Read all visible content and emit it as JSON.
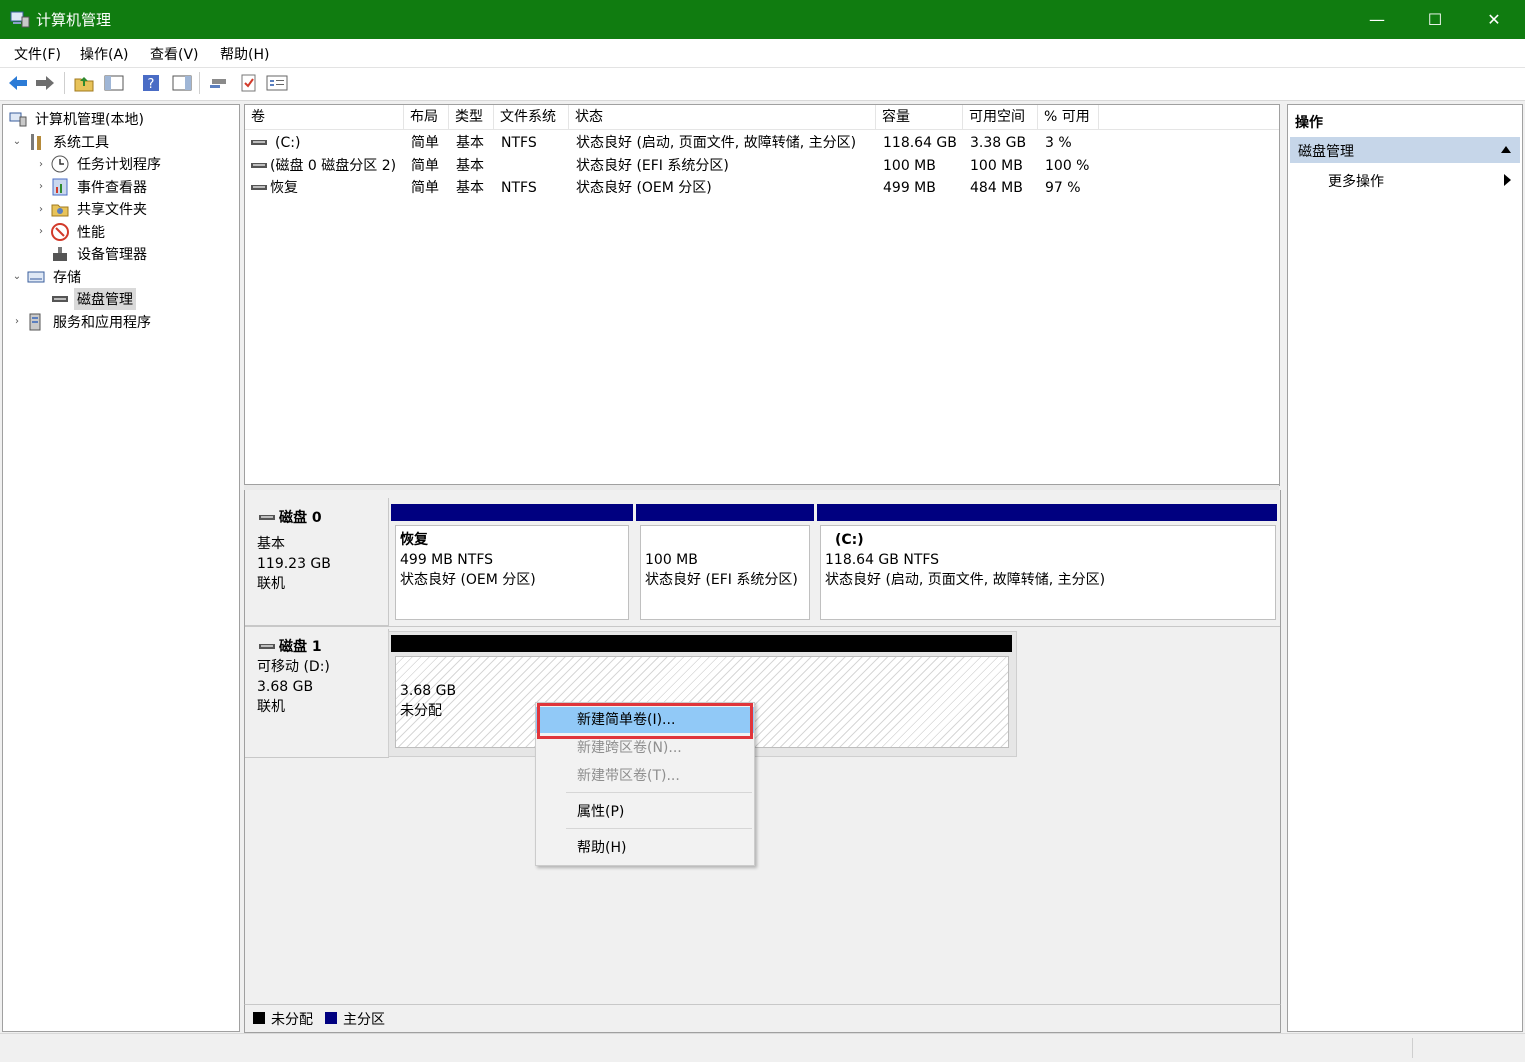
{
  "window": {
    "title": "计算机管理",
    "minimize": "—",
    "maximize": "☐",
    "close": "✕"
  },
  "menu": [
    "文件(F)",
    "操作(A)",
    "查看(V)",
    "帮助(H)"
  ],
  "toolbar_icons": [
    "back-icon",
    "forward-icon",
    "folder-up-icon",
    "show-hide-tree-icon",
    "help-icon",
    "show-action-pane-icon",
    "connect-icon",
    "checklist-icon",
    "properties-icon"
  ],
  "tree": {
    "root": "计算机管理(本地)",
    "items": [
      {
        "label": "系统工具",
        "level": 1,
        "toggle": "⌄",
        "icon": "tools-icon"
      },
      {
        "label": "任务计划程序",
        "level": 2,
        "toggle": "›",
        "icon": "clock-icon"
      },
      {
        "label": "事件查看器",
        "level": 2,
        "toggle": "›",
        "icon": "event-viewer-icon"
      },
      {
        "label": "共享文件夹",
        "level": 2,
        "toggle": "›",
        "icon": "shared-folder-icon"
      },
      {
        "label": "性能",
        "level": 2,
        "toggle": "›",
        "icon": "performance-icon"
      },
      {
        "label": "设备管理器",
        "level": 2,
        "toggle": "",
        "icon": "device-manager-icon"
      },
      {
        "label": "存储",
        "level": 1,
        "toggle": "⌄",
        "icon": "storage-icon"
      },
      {
        "label": "磁盘管理",
        "level": 2,
        "toggle": "",
        "icon": "disk-icon",
        "selected": true
      },
      {
        "label": "服务和应用程序",
        "level": 1,
        "toggle": "›",
        "icon": "services-icon"
      }
    ]
  },
  "volumes": {
    "columns": [
      "卷",
      "布局",
      "类型",
      "文件系统",
      "状态",
      "容量",
      "可用空间",
      "% 可用"
    ],
    "rows": [
      [
        "(C:)",
        "简单",
        "基本",
        "NTFS",
        "状态良好 (启动, 页面文件, 故障转储, 主分区)",
        "118.64 GB",
        "3.38 GB",
        "3 %"
      ],
      [
        "(磁盘 0 磁盘分区 2)",
        "简单",
        "基本",
        "",
        "状态良好 (EFI 系统分区)",
        "100 MB",
        "100 MB",
        "100 %"
      ],
      [
        "恢复",
        "简单",
        "基本",
        "NTFS",
        "状态良好 (OEM 分区)",
        "499 MB",
        "484 MB",
        "97 %"
      ]
    ]
  },
  "disks": {
    "disk0": {
      "name": "磁盘 0",
      "type": "基本",
      "size": "119.23 GB",
      "status": "联机",
      "partitions": [
        {
          "name": "恢复",
          "size": "499 MB NTFS",
          "status": "状态良好 (OEM 分区)"
        },
        {
          "name": "",
          "size": "100 MB",
          "status": "状态良好 (EFI 系统分区)"
        },
        {
          "name": "(C:)",
          "size": "118.64 GB NTFS",
          "status": "状态良好 (启动, 页面文件, 故障转储, 主分区)"
        }
      ]
    },
    "disk1": {
      "name": "磁盘 1",
      "type": "可移动 (D:)",
      "size": "3.68 GB",
      "status": "联机",
      "partition": {
        "size": "3.68 GB",
        "status": "未分配"
      }
    }
  },
  "legend": {
    "unallocated": "未分配",
    "primary": "主分区",
    "unallocated_color": "#000000",
    "primary_color": "#000080"
  },
  "actions": {
    "header": "操作",
    "section": "磁盘管理",
    "more": "更多操作"
  },
  "context_menu": {
    "items": [
      "新建简单卷(I)...",
      "新建跨区卷(N)...",
      "新建带区卷(T)...",
      "属性(P)",
      "帮助(H)"
    ],
    "highlighted": "新建简单卷(I)..."
  },
  "colors": {
    "titlebar": "#107c10",
    "primary_partition": "#000080",
    "unallocated": "#000000",
    "menu_highlight": "#91c9f7",
    "callout": "#e0353b"
  }
}
